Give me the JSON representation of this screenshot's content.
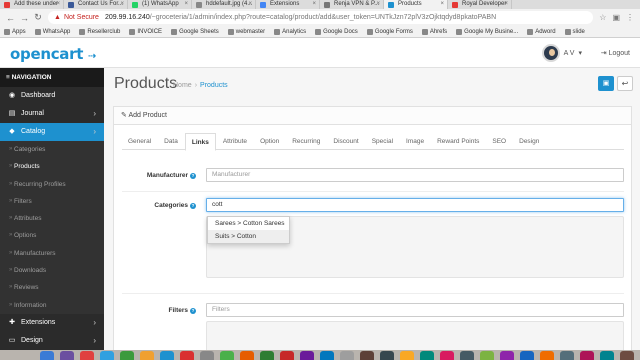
{
  "browser": {
    "tabs": [
      {
        "title": "Add these under",
        "color": "#e53935"
      },
      {
        "title": "Contact Us For...",
        "color": "#3b5998"
      },
      {
        "title": "(1) WhatsApp",
        "color": "#25d366"
      },
      {
        "title": "hddefault.jpg (4...",
        "color": "#888888"
      },
      {
        "title": "Extensions",
        "color": "#4285f4"
      },
      {
        "title": "Renja VPN & P...",
        "color": "#777777"
      },
      {
        "title": "Products",
        "color": "#1e91cf",
        "active": true
      },
      {
        "title": "Royal Developer",
        "color": "#e53935"
      }
    ],
    "security": "Not Secure",
    "url_host": "209.99.16.240",
    "url_path": "/~groceteria/1/admin/index.php?route=catalog/product/add&user_token=UNTkJzn72plV3zOjktqdyd8pkatoPABN",
    "bookmarks": [
      "Apps",
      "WhatsApp",
      "Resellerclub",
      "INVOICE",
      "Google Sheets",
      "webmaster",
      "Analytics",
      "Google Docs",
      "Google Forms",
      "Ahrefs",
      "Google My Busine...",
      "Adword",
      "slide"
    ]
  },
  "header": {
    "logo": "opencart",
    "user_name": "A V",
    "logout": "Logout"
  },
  "sidebar": {
    "title": "NAVIGATION",
    "items": [
      {
        "label": "Dashboard",
        "icon": "dashboard-icon",
        "glyph": "◉"
      },
      {
        "label": "Journal",
        "icon": "book-icon",
        "glyph": "▤",
        "caret": true
      },
      {
        "label": "Catalog",
        "icon": "tag-icon",
        "glyph": "◆",
        "caret": true,
        "active": true
      }
    ],
    "submenu": [
      "Categories",
      "Products",
      "Recurring Profiles",
      "Filters",
      "Attributes",
      "Options",
      "Manufacturers",
      "Downloads",
      "Reviews",
      "Information"
    ],
    "bottom": [
      {
        "label": "Extensions",
        "icon": "puzzle-icon",
        "glyph": "✚",
        "caret": true
      },
      {
        "label": "Design",
        "icon": "monitor-icon",
        "glyph": "▭",
        "caret": true
      }
    ]
  },
  "page": {
    "title": "Products",
    "crumb_home": "Home",
    "crumb_sep": "›",
    "crumb_current": "Products",
    "panel_title": "Add Product"
  },
  "tabs": [
    "General",
    "Data",
    "Links",
    "Attribute",
    "Option",
    "Recurring",
    "Discount",
    "Special",
    "Image",
    "Reward Points",
    "SEO",
    "Design"
  ],
  "form": {
    "manufacturer_label": "Manufacturer",
    "manufacturer_placeholder": "Manufacturer",
    "categories_label": "Categories",
    "categories_value": "cott",
    "suggestions": [
      "Sarees  >  Cotton Sarees",
      "Suits  >  Cotton"
    ],
    "filters_label": "Filters",
    "filters_placeholder": "Filters"
  },
  "colors": {
    "accent": "#1e91cf",
    "sidebar_bg": "#2b2b2b"
  },
  "dock_colors": [
    "#3a7bd5",
    "#6b4fa0",
    "#e04040",
    "#30a0e0",
    "#3c9a3c",
    "#f0a030",
    "#1e91cf",
    "#d93030",
    "#888",
    "#4ab04a",
    "#e65c00",
    "#2e7d32",
    "#c62828",
    "#6a1b9a",
    "#0277bd",
    "#9e9e9e",
    "#5d4037",
    "#37474f",
    "#f9a825",
    "#00897b",
    "#d81b60",
    "#455a64",
    "#7cb342",
    "#8e24aa",
    "#1565c0",
    "#ef6c00",
    "#546e7a",
    "#ad1457",
    "#00838f",
    "#6d4c41"
  ]
}
